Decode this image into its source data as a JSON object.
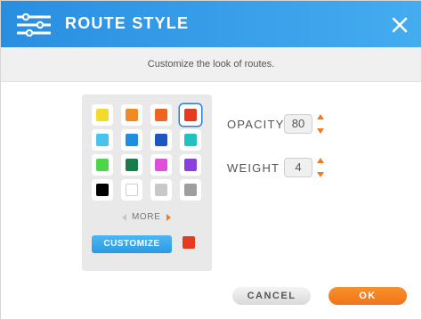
{
  "header": {
    "title": "ROUTE STYLE",
    "icon": "sliders-icon",
    "close_icon": "close-icon",
    "bg_color": "#3aa0ea"
  },
  "subheader": {
    "text": "Customize the look of routes."
  },
  "palette": {
    "selected_index": 3,
    "swatches": [
      "#f2dc2b",
      "#f08a22",
      "#ee6423",
      "#e53a20",
      "#46c4ee",
      "#1e8fe0",
      "#1d55c5",
      "#20c2c0",
      "#4ed64b",
      "#167c4a",
      "#dd50d8",
      "#8a3fe0",
      "#000000",
      "#ffffff",
      "#c8c8c8",
      "#9e9e9e"
    ],
    "more_label": "MORE",
    "customize_label": "CUSTOMIZE",
    "current_color": "#e53a20"
  },
  "opacity": {
    "label": "OPACITY",
    "value": "80"
  },
  "weight": {
    "label": "WEIGHT",
    "value": "4"
  },
  "footer": {
    "cancel_label": "CANCEL",
    "ok_label": "OK"
  },
  "colors": {
    "accent": "#f07c22",
    "primary": "#2a9be3"
  }
}
